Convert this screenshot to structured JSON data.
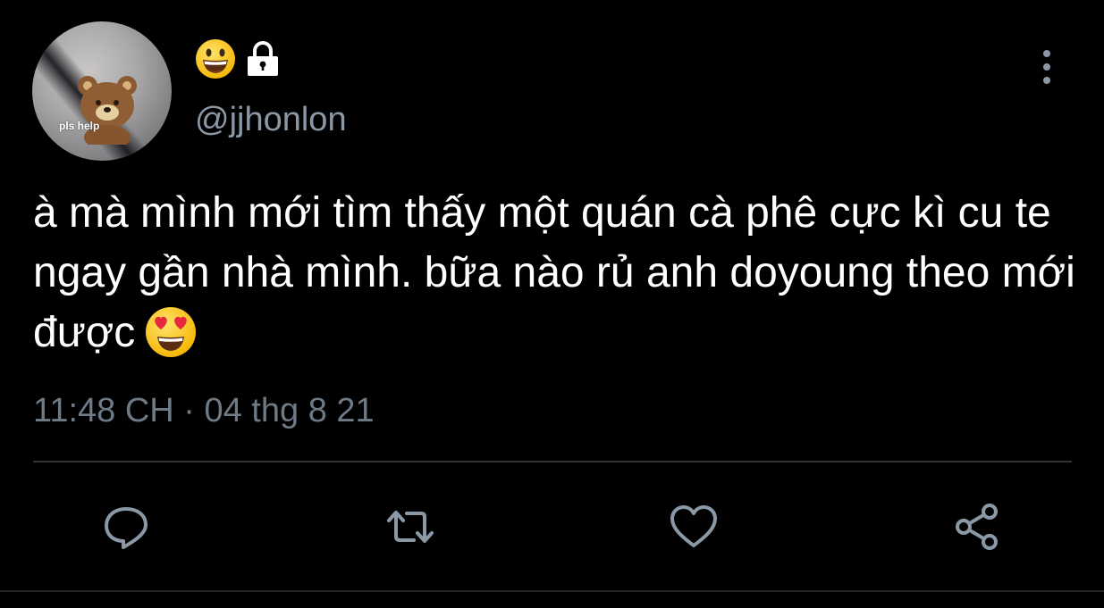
{
  "author": {
    "avatar_caption": "pls help",
    "name_emoji": "grinning-face-emoji",
    "protected_icon": "lock-icon",
    "handle": "@jjhonlon"
  },
  "tweet": {
    "text": "à mà mình mới tìm thấy một quán cà phê cực kì cu te ngay gần nhà mình. bữa nào rủ anh doyoung theo mới được",
    "trailing_emoji": "heart-eyes-emoji",
    "timestamp": "11:48 CH · 04 thg 8 21"
  },
  "actions": [
    {
      "icon": "reply-icon"
    },
    {
      "icon": "retweet-icon"
    },
    {
      "icon": "like-icon"
    },
    {
      "icon": "share-icon"
    }
  ],
  "colors": {
    "background": "#000000",
    "text": "#ffffff",
    "secondary_text": "#8b98a5",
    "timestamp_text": "#6e7a86",
    "icon": "#8b98a5",
    "divider": "#2f3336"
  }
}
